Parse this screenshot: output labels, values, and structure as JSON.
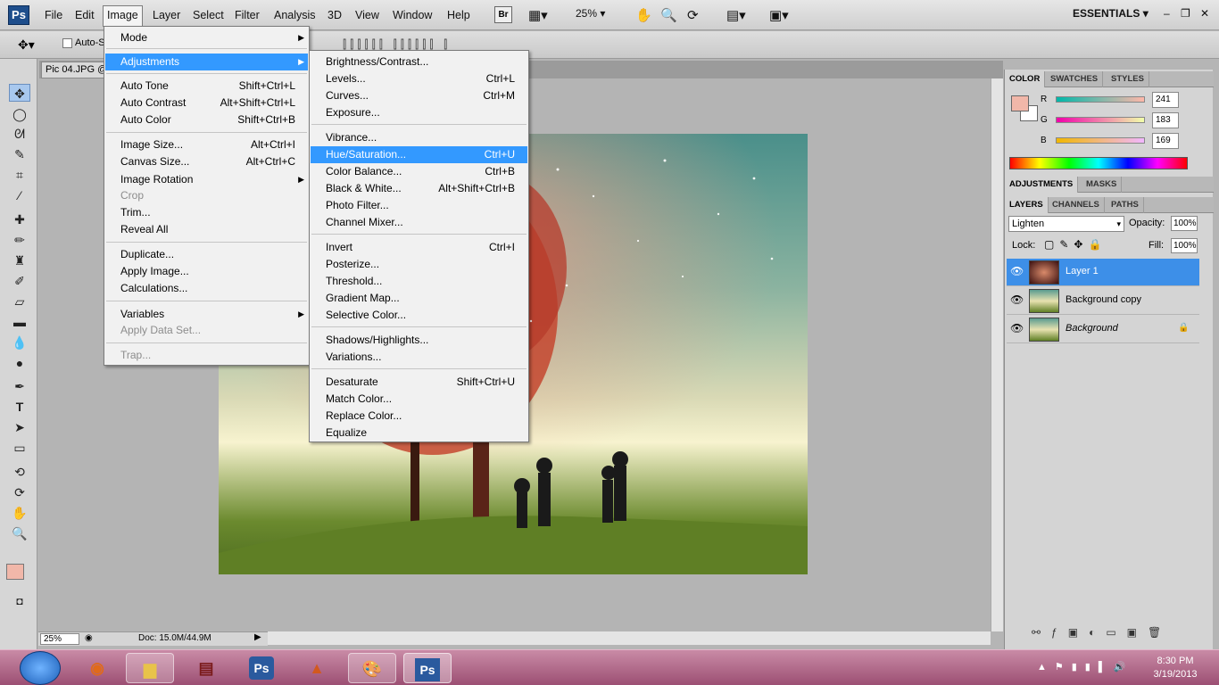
{
  "app": {
    "logo": "Ps"
  },
  "menubar": {
    "items": [
      "File",
      "Edit",
      "Image",
      "Layer",
      "Select",
      "Filter",
      "Analysis",
      "3D",
      "View",
      "Window",
      "Help"
    ],
    "br_badge": "Br",
    "zoom": "25%",
    "workspace": "ESSENTIALS"
  },
  "options": {
    "auto_select": "Auto-S"
  },
  "document": {
    "tab_title": "Pic 04.JPG @"
  },
  "image_menu": {
    "items": [
      {
        "label": "Mode",
        "shortcut": "",
        "submenu": true
      },
      {
        "label": "Adjustments",
        "shortcut": "",
        "submenu": true,
        "highlighted": true
      },
      {
        "label": "Auto Tone",
        "shortcut": "Shift+Ctrl+L"
      },
      {
        "label": "Auto Contrast",
        "shortcut": "Alt+Shift+Ctrl+L"
      },
      {
        "label": "Auto Color",
        "shortcut": "Shift+Ctrl+B"
      },
      {
        "label": "Image Size...",
        "shortcut": "Alt+Ctrl+I"
      },
      {
        "label": "Canvas Size...",
        "shortcut": "Alt+Ctrl+C"
      },
      {
        "label": "Image Rotation",
        "shortcut": "",
        "submenu": true
      },
      {
        "label": "Crop",
        "shortcut": "",
        "disabled": true
      },
      {
        "label": "Trim...",
        "shortcut": ""
      },
      {
        "label": "Reveal All",
        "shortcut": ""
      },
      {
        "label": "Duplicate...",
        "shortcut": ""
      },
      {
        "label": "Apply Image...",
        "shortcut": ""
      },
      {
        "label": "Calculations...",
        "shortcut": ""
      },
      {
        "label": "Variables",
        "shortcut": "",
        "submenu": true
      },
      {
        "label": "Apply Data Set...",
        "shortcut": "",
        "disabled": true
      },
      {
        "label": "Trap...",
        "shortcut": "",
        "disabled": true
      }
    ]
  },
  "adjustments_menu": {
    "items": [
      {
        "label": "Brightness/Contrast...",
        "shortcut": ""
      },
      {
        "label": "Levels...",
        "shortcut": "Ctrl+L"
      },
      {
        "label": "Curves...",
        "shortcut": "Ctrl+M"
      },
      {
        "label": "Exposure...",
        "shortcut": ""
      },
      {
        "label": "Vibrance...",
        "shortcut": ""
      },
      {
        "label": "Hue/Saturation...",
        "shortcut": "Ctrl+U",
        "highlighted": true
      },
      {
        "label": "Color Balance...",
        "shortcut": "Ctrl+B"
      },
      {
        "label": "Black & White...",
        "shortcut": "Alt+Shift+Ctrl+B"
      },
      {
        "label": "Photo Filter...",
        "shortcut": ""
      },
      {
        "label": "Channel Mixer...",
        "shortcut": ""
      },
      {
        "label": "Invert",
        "shortcut": "Ctrl+I"
      },
      {
        "label": "Posterize...",
        "shortcut": ""
      },
      {
        "label": "Threshold...",
        "shortcut": ""
      },
      {
        "label": "Gradient Map...",
        "shortcut": ""
      },
      {
        "label": "Selective Color...",
        "shortcut": ""
      },
      {
        "label": "Shadows/Highlights...",
        "shortcut": ""
      },
      {
        "label": "Variations...",
        "shortcut": ""
      },
      {
        "label": "Desaturate",
        "shortcut": "Shift+Ctrl+U"
      },
      {
        "label": "Match Color...",
        "shortcut": ""
      },
      {
        "label": "Replace Color...",
        "shortcut": ""
      },
      {
        "label": "Equalize",
        "shortcut": ""
      }
    ]
  },
  "color_panel": {
    "tabs": [
      "COLOR",
      "SWATCHES",
      "STYLES"
    ],
    "r_label": "R",
    "g_label": "G",
    "b_label": "B",
    "r": "241",
    "g": "183",
    "b": "169",
    "foreground": "#f1b7a9"
  },
  "adjustments_panel": {
    "tabs": [
      "ADJUSTMENTS",
      "MASKS"
    ]
  },
  "layers_panel": {
    "tabs": [
      "LAYERS",
      "CHANNELS",
      "PATHS"
    ],
    "blend_mode": "Lighten",
    "opacity_label": "Opacity:",
    "opacity": "100%",
    "lock_label": "Lock:",
    "fill_label": "Fill:",
    "fill": "100%",
    "layers": [
      {
        "name": "Layer 1",
        "selected": true
      },
      {
        "name": "Background copy",
        "selected": false
      },
      {
        "name": "Background",
        "selected": false
      }
    ]
  },
  "status": {
    "zoom": "25%",
    "doc": "Doc: 15.0M/44.9M"
  },
  "taskbar": {
    "time": "8:30 PM",
    "date": "3/19/2013"
  }
}
